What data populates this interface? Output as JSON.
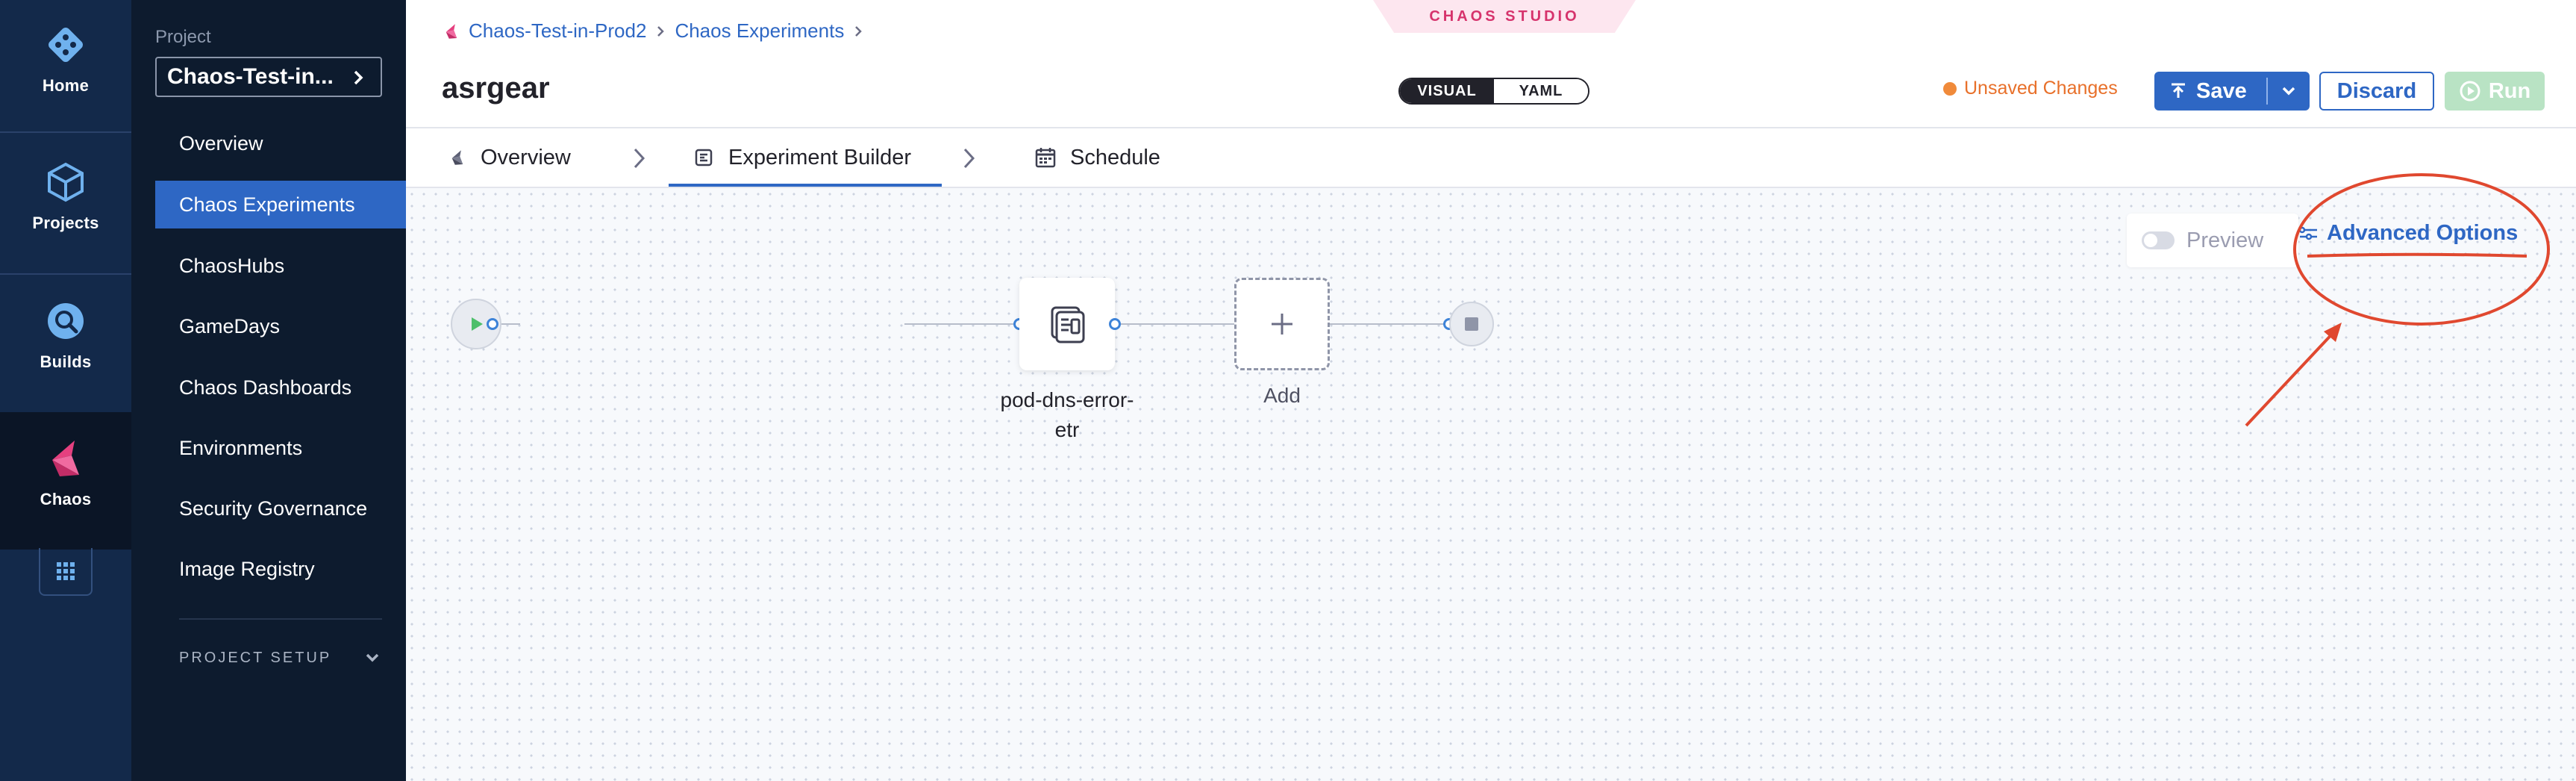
{
  "rail": {
    "items": [
      {
        "label": "Home",
        "icon": "home-icon"
      },
      {
        "label": "Projects",
        "icon": "projects-icon"
      },
      {
        "label": "Builds",
        "icon": "builds-icon"
      },
      {
        "label": "Chaos",
        "icon": "chaos-icon",
        "active": true
      }
    ],
    "grid_icon": "app-grid-icon"
  },
  "sidebar": {
    "project_caption": "Project",
    "project_name": "Chaos-Test-in...",
    "items": [
      {
        "label": "Overview"
      },
      {
        "label": "Chaos Experiments",
        "active": true
      },
      {
        "label": "ChaosHubs"
      },
      {
        "label": "GameDays"
      },
      {
        "label": "Chaos Dashboards"
      },
      {
        "label": "Environments"
      },
      {
        "label": "Security Governance"
      },
      {
        "label": "Image Registry"
      }
    ],
    "project_setup": "PROJECT SETUP"
  },
  "header": {
    "studio_tab": "CHAOS STUDIO",
    "breadcrumbs": [
      "Chaos-Test-in-Prod2",
      "Chaos Experiments"
    ],
    "title": "asrgear",
    "view_toggle": {
      "visual": "VISUAL",
      "yaml": "YAML",
      "selected": "VISUAL"
    },
    "unsaved": "Unsaved Changes",
    "save": "Save",
    "discard": "Discard",
    "run": "Run"
  },
  "tabs": [
    {
      "label": "Overview",
      "icon": "chaos-icon"
    },
    {
      "label": "Experiment Builder",
      "icon": "builder-icon",
      "active": true
    },
    {
      "label": "Schedule",
      "icon": "calendar-icon"
    }
  ],
  "canvas": {
    "preview_label": "Preview",
    "preview_enabled": false,
    "advanced_options": "Advanced Options",
    "step_node_label": "pod-dns-error-\netr",
    "step_node_line1": "pod-dns-error-",
    "step_node_line2": "etr",
    "add_label": "Add"
  },
  "colors": {
    "rail_bg": "#13294a",
    "sidebar_bg": "#0d1b2e",
    "accent": "#2e67c4",
    "warning": "#e8702a",
    "annotation": "#e0482f",
    "run_disabled": "#b9e3c4"
  }
}
